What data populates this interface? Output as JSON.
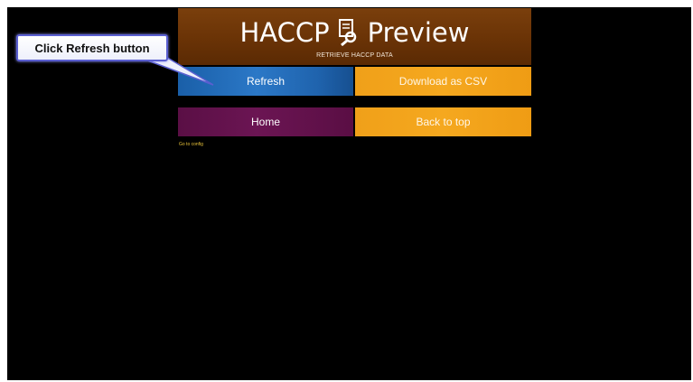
{
  "header": {
    "title_left": "HACCP",
    "title_right": "Preview",
    "subtitle": "RETRIEVE HACCP DATA",
    "title_icon": "document-search-icon"
  },
  "buttons": {
    "refresh": "Refresh",
    "download_csv": "Download as CSV",
    "home": "Home",
    "back_to_top": "Back to top"
  },
  "links": {
    "config": "Go to config"
  },
  "callout": {
    "text": "Click Refresh button"
  },
  "colors": {
    "header": "#6a3306",
    "refresh": "#2b78c7",
    "orange": "#f5a81f",
    "home": "#6b1553",
    "link": "#e8c23a",
    "callout_border": "#5a5fd0"
  }
}
